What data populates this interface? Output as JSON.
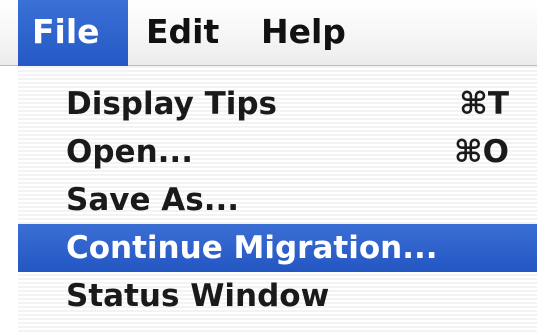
{
  "menubar": {
    "items": [
      {
        "label": "File",
        "active": true
      },
      {
        "label": "Edit",
        "active": false
      },
      {
        "label": "Help",
        "active": false
      }
    ]
  },
  "file_menu": {
    "items": [
      {
        "label": "Display Tips",
        "shortcut": "⌘T"
      },
      {
        "label": "Open...",
        "shortcut": "⌘O"
      },
      {
        "label": "Save As...",
        "shortcut": ""
      },
      {
        "label": "Continue Migration...",
        "shortcut": "",
        "highlighted": true
      },
      {
        "label": "Status Window",
        "shortcut": ""
      }
    ]
  },
  "colors": {
    "highlight": "#2a5fcb",
    "menu_text": "#1a1a1a"
  }
}
